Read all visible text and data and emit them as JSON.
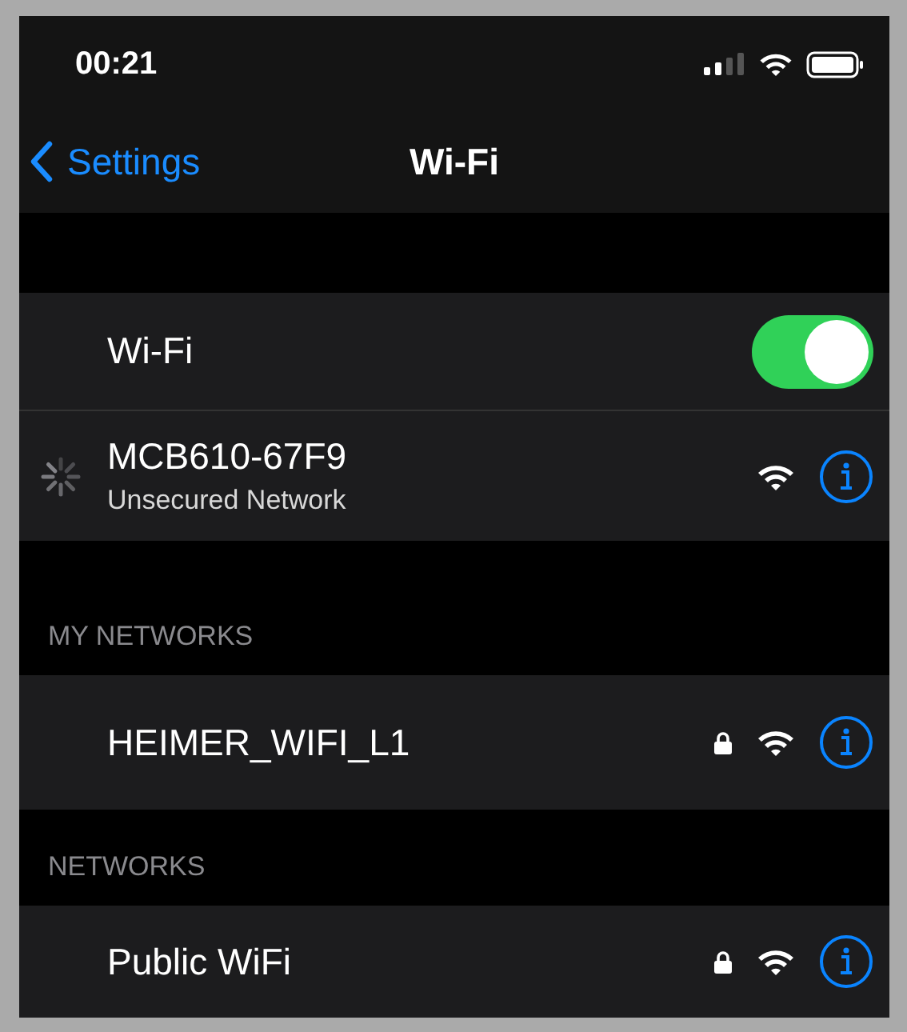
{
  "status_bar": {
    "time": "00:21"
  },
  "nav": {
    "back_label": "Settings",
    "title": "Wi-Fi"
  },
  "wifi_toggle": {
    "label": "Wi-Fi",
    "on": true
  },
  "current_network": {
    "name": "MCB610-67F9",
    "subtitle": "Unsecured Network",
    "connecting": true,
    "secured": false
  },
  "sections": [
    {
      "header": "MY NETWORKS",
      "networks": [
        {
          "name": "HEIMER_WIFI_L1",
          "secured": true
        }
      ]
    },
    {
      "header": "NETWORKS",
      "networks": [
        {
          "name": "Public WiFi",
          "secured": true
        }
      ]
    }
  ]
}
